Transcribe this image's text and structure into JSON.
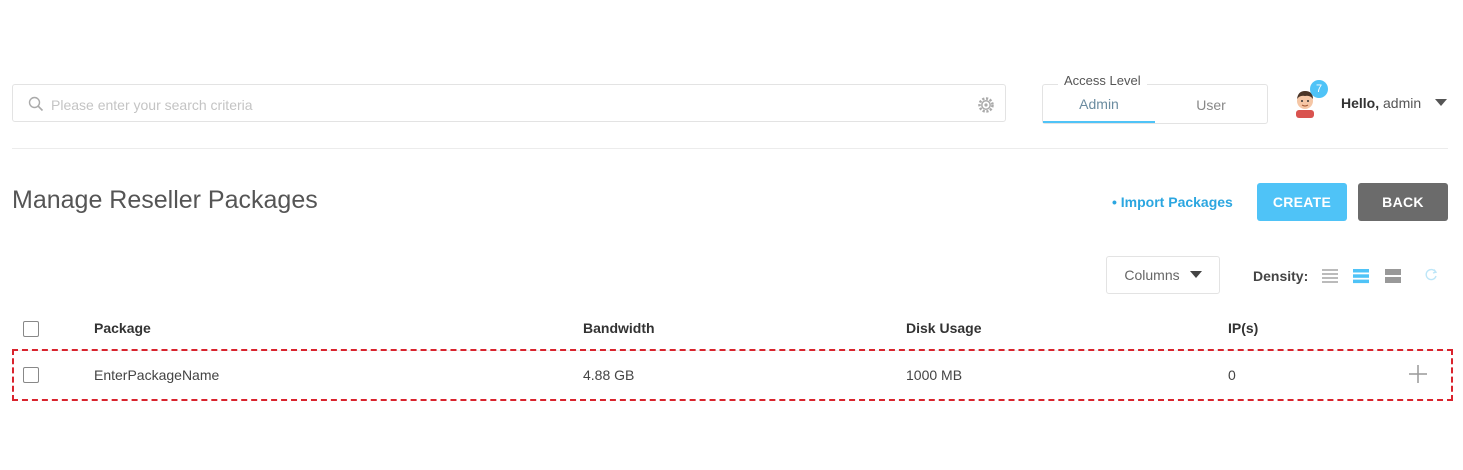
{
  "search": {
    "placeholder": "Please enter your search criteria"
  },
  "access_level": {
    "title": "Access Level",
    "options": [
      {
        "label": "Admin",
        "active": true
      },
      {
        "label": "User",
        "active": false
      }
    ]
  },
  "user": {
    "greeting": "Hello,",
    "name": "admin",
    "notification_count": "7"
  },
  "page": {
    "title": "Manage Reseller Packages",
    "import_label": "Import Packages",
    "create_label": "CREATE",
    "back_label": "BACK"
  },
  "toolbar": {
    "columns_label": "Columns",
    "density_label": "Density:"
  },
  "table": {
    "headers": [
      "Package",
      "Bandwidth",
      "Disk Usage",
      "IP(s)"
    ],
    "rows": [
      {
        "package": "EnterPackageName",
        "bandwidth": "4.88 GB",
        "disk": "1000 MB",
        "ips": "0"
      }
    ]
  },
  "colors": {
    "accent": "#4fc3f7",
    "link": "#2ba6e0",
    "back_button": "#6b6b6b",
    "highlight": "#d9232d"
  }
}
